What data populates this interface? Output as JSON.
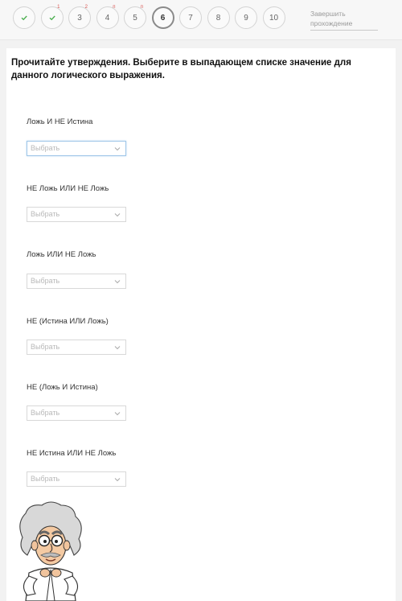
{
  "steps": [
    {
      "label": "",
      "state": "done",
      "mark": ""
    },
    {
      "label": "",
      "state": "done",
      "mark": "1"
    },
    {
      "label": "3",
      "state": "normal",
      "mark": "2"
    },
    {
      "label": "4",
      "state": "normal",
      "mark": "п"
    },
    {
      "label": "5",
      "state": "normal",
      "mark": "п"
    },
    {
      "label": "6",
      "state": "current",
      "mark": ""
    },
    {
      "label": "7",
      "state": "normal",
      "mark": ""
    },
    {
      "label": "8",
      "state": "normal",
      "mark": ""
    },
    {
      "label": "9",
      "state": "normal",
      "mark": ""
    },
    {
      "label": "10",
      "state": "normal",
      "mark": ""
    }
  ],
  "finish_label": "Завершить прохождение",
  "question": "Прочитайте утверждения. Выберите в выпадающем списке значение для данного логического выражения.",
  "items": [
    {
      "label": "Ложь И НЕ Истина",
      "placeholder": "Выбрать"
    },
    {
      "label": "НЕ Ложь ИЛИ НЕ Ложь",
      "placeholder": "Выбрать"
    },
    {
      "label": "Ложь ИЛИ НЕ Ложь",
      "placeholder": "Выбрать"
    },
    {
      "label": "НЕ (Истина ИЛИ Ложь)",
      "placeholder": "Выбрать"
    },
    {
      "label": "НЕ (Ложь И Истина)",
      "placeholder": "Выбрать"
    },
    {
      "label": "НЕ Истина ИЛИ НЕ Ложь",
      "placeholder": "Выбрать"
    }
  ],
  "colors": {
    "check": "#4caf50",
    "mark": "#d9534f",
    "focus": "#9fc6e8"
  }
}
